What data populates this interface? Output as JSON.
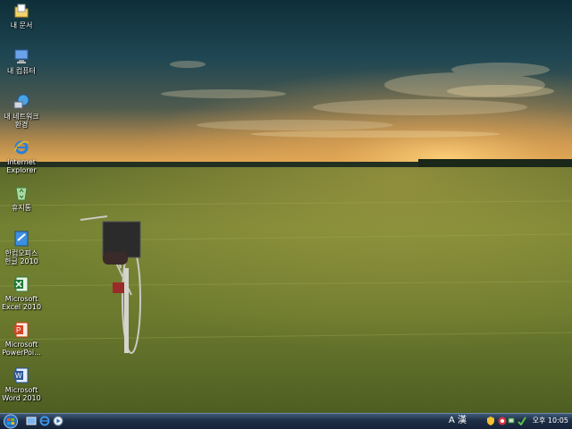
{
  "desktop": {
    "icons": [
      {
        "label": "내 문서",
        "icon": "folder-icon"
      },
      {
        "label": "내 컴퓨터",
        "icon": "computer-icon"
      },
      {
        "label": "내 네트워크\n환경",
        "icon": "network-icon"
      },
      {
        "label": "Internet\nExplorer",
        "icon": "ie-icon"
      },
      {
        "label": "휴지통",
        "icon": "recycle-bin-icon"
      },
      {
        "label": "한컴오피스\n한글 2010",
        "icon": "hwp-icon"
      },
      {
        "label": "Microsoft\nExcel 2010",
        "icon": "excel-icon"
      },
      {
        "label": "Microsoft\nPowerPoi...",
        "icon": "powerpoint-icon"
      },
      {
        "label": "Microsoft\nWord 2010",
        "icon": "word-icon"
      }
    ]
  },
  "taskbar": {
    "start_icon": "windows-orb-icon",
    "quick_launch": [
      "show-desktop-icon",
      "ie-icon",
      "media-player-icon"
    ],
    "tray": {
      "ime_mode": "A",
      "ime_lang": "漢",
      "icons": [
        "security-shield-icon",
        "antivirus-icon",
        "network-status-icon",
        "sync-icon"
      ],
      "clock": "오후 10:05"
    }
  }
}
